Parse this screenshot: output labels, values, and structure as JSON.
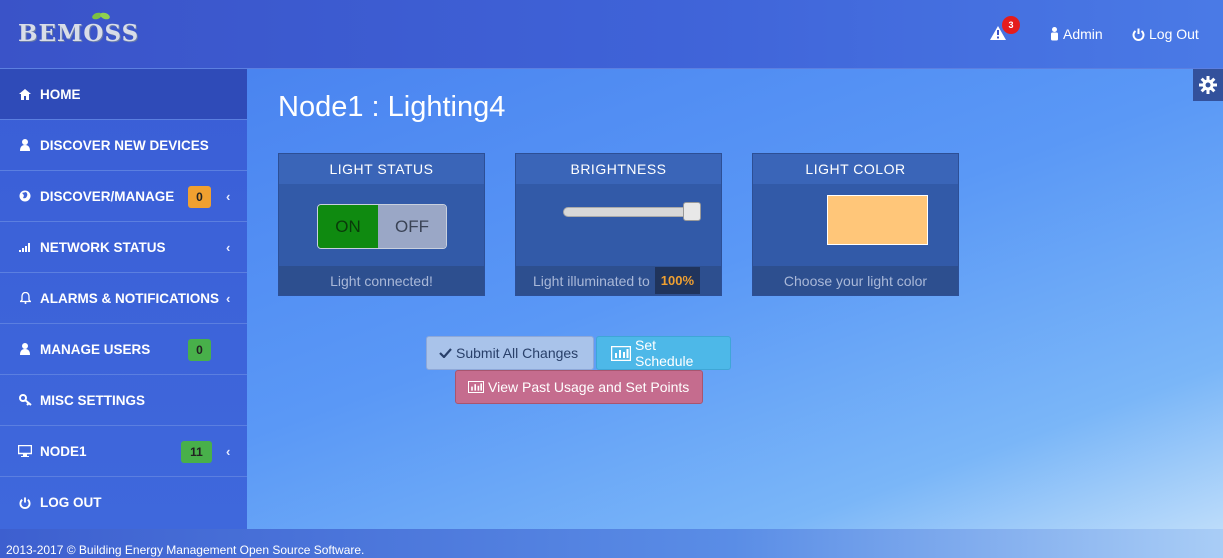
{
  "header": {
    "logo_text": "BEMOSS",
    "alerts_count": "3",
    "admin_label": "Admin",
    "logout_label": "Log Out"
  },
  "sidebar": {
    "items": [
      {
        "label": "HOME",
        "icon": "home-icon"
      },
      {
        "label": "DISCOVER NEW DEVICES",
        "icon": "user-icon"
      },
      {
        "label": "DISCOVER/MANAGE",
        "icon": "globe-icon",
        "badge": "0"
      },
      {
        "label": "NETWORK STATUS",
        "icon": "signal-icon"
      },
      {
        "label": "ALARMS & NOTIFICATIONS",
        "icon": "bell-icon"
      },
      {
        "label": "MANAGE USERS",
        "icon": "user-icon",
        "badge": "0"
      },
      {
        "label": "MISC SETTINGS",
        "icon": "key-icon"
      },
      {
        "label": "NODE1",
        "icon": "monitor-icon",
        "badge": "11"
      },
      {
        "label": "LOG OUT",
        "icon": "power-icon"
      }
    ]
  },
  "main": {
    "title": "Node1 : Lighting4",
    "light_status": {
      "title": "LIGHT STATUS",
      "on_label": "ON",
      "off_label": "OFF",
      "footer": "Light connected!"
    },
    "brightness": {
      "title": "BRIGHTNESS",
      "level": 1.0,
      "footer_label": "Light illuminated to",
      "value": "100%"
    },
    "light_color": {
      "title": "LIGHT COLOR",
      "color": "#ffc679",
      "footer": "Choose your light color"
    },
    "buttons": {
      "submit": "Submit All Changes",
      "schedule": "Set Schedule",
      "past_usage": "View Past Usage and Set Points"
    }
  },
  "footer": {
    "text": "2013-2017 © Building Energy Management Open Source Software."
  },
  "colors": {
    "accent_orange": "#f0a030",
    "badge_green": "#48b04a",
    "alert_red": "#e51c1c",
    "toggle_on": "#0f8a10"
  }
}
